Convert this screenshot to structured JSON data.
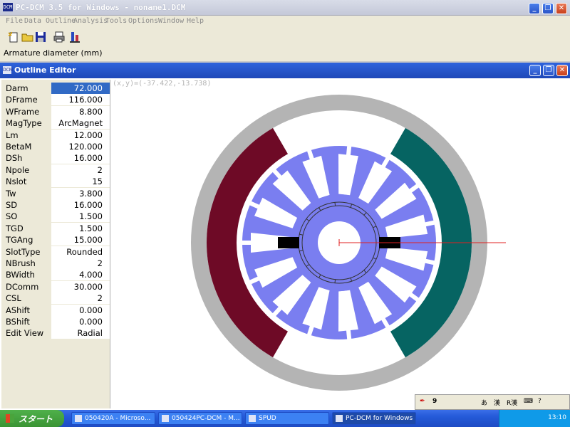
{
  "app": {
    "title": "PC-DCM 3.5 for Windows - noname1.DCM"
  },
  "menu": [
    "File",
    "Data",
    "Outline",
    "Analysis",
    "Tools",
    "Options",
    "Window",
    "Help"
  ],
  "toolbar_icons": [
    "new-icon",
    "open-icon",
    "save-icon",
    "print-icon",
    "motor-icon"
  ],
  "status_field": "Armature diameter (mm)",
  "child": {
    "title": "Outline Editor",
    "coords": "(x,y)=(-37.422,-13.738)"
  },
  "params": [
    {
      "k": "Darm",
      "v": "72.000"
    },
    {
      "k": "DFrame",
      "v": "116.000"
    },
    {
      "k": "WFrame",
      "v": "8.800"
    },
    {
      "k": "MagType",
      "v": "ArcMagnet"
    },
    {
      "k": "Lm",
      "v": "12.000"
    },
    {
      "k": "BetaM",
      "v": "120.000"
    },
    {
      "k": "DSh",
      "v": "16.000"
    },
    {
      "k": "Npole",
      "v": "2"
    },
    {
      "k": "Nslot",
      "v": "15"
    },
    {
      "k": "Tw",
      "v": "3.800"
    },
    {
      "k": "SD",
      "v": "16.000"
    },
    {
      "k": "SO",
      "v": "1.500"
    },
    {
      "k": "TGD",
      "v": "1.500"
    },
    {
      "k": "TGAng",
      "v": "15.000"
    },
    {
      "k": "SlotType",
      "v": "Rounded"
    },
    {
      "k": "NBrush",
      "v": "2"
    },
    {
      "k": "BWidth",
      "v": "4.000"
    },
    {
      "k": "DComm",
      "v": "30.000"
    },
    {
      "k": "CSL",
      "v": "2"
    },
    {
      "k": "AShift",
      "v": "0.000"
    },
    {
      "k": "BShift",
      "v": "0.000"
    },
    {
      "k": "Edit View",
      "v": "Radial"
    }
  ],
  "colors": {
    "frame": "#b4b4b4",
    "magnet_left": "#6e0a26",
    "magnet_right": "#066462",
    "armature": "#7a7ef0",
    "brush": "#000000",
    "axis": "#e02020",
    "selection": "#316ac5"
  },
  "taskbar": {
    "start": "スタート",
    "tasks": [
      "050420A - Microso...",
      "050424PC-DCM - M...",
      "SPUD",
      "PC-DCM for Windows"
    ],
    "clock": "13:10"
  },
  "ime": {
    "mode": "あ",
    "chars": "漢",
    "kana": "R漢"
  }
}
